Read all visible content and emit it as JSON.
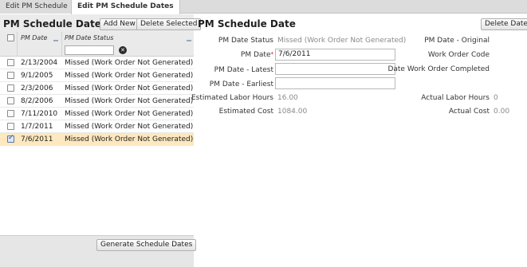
{
  "tabs": [
    {
      "label": "Edit PM Schedule"
    },
    {
      "label": "Edit PM Schedule Dates"
    }
  ],
  "left": {
    "title": "PM Schedule Dates",
    "add_label": "Add New",
    "delete_selected_label": "Delete Selected",
    "columns": {
      "date": "PM Date",
      "status": "PM Date Status"
    },
    "rows": [
      {
        "date": "2/13/2004",
        "status": "Missed (Work Order Not Generated)",
        "checked": false
      },
      {
        "date": "9/1/2005",
        "status": "Missed (Work Order Not Generated)",
        "checked": false
      },
      {
        "date": "2/3/2006",
        "status": "Missed (Work Order Not Generated)",
        "checked": false
      },
      {
        "date": "8/2/2006",
        "status": "Missed (Work Order Not Generated)",
        "checked": false
      },
      {
        "date": "7/11/2010",
        "status": "Missed (Work Order Not Generated)",
        "checked": false
      },
      {
        "date": "1/7/2011",
        "status": "Missed (Work Order Not Generated)",
        "checked": false
      },
      {
        "date": "7/6/2011",
        "status": "Missed (Work Order Not Generated)",
        "checked": true
      }
    ],
    "generate_label": "Generate Schedule Dates"
  },
  "right": {
    "title": "PM Schedule Date",
    "delete_label": "Delete Date",
    "fields": {
      "status_label": "PM Date Status",
      "status_value": "Missed (Work Order Not Generated)",
      "pm_date_label": "PM Date",
      "pm_date_value": "7/6/2011",
      "latest_label": "PM Date - Latest",
      "latest_value": "",
      "earliest_label": "PM Date - Earliest",
      "earliest_value": "",
      "est_hours_label": "Estimated Labor Hours",
      "est_hours_value": "16.00",
      "est_cost_label": "Estimated Cost",
      "est_cost_value": "1084.00",
      "original_label": "PM Date - Original",
      "original_value": "",
      "wo_code_label": "Work Order Code",
      "wo_code_value": "",
      "completed_label": "Date Work Order Completed",
      "completed_value": "",
      "actual_hours_label": "Actual Labor Hours",
      "actual_hours_value": "0",
      "actual_cost_label": "Actual Cost",
      "actual_cost_value": "0.00"
    },
    "required_mark": "*"
  },
  "colors": {
    "selected_row": "#fde8bf",
    "panel_bg": "#ebebeb"
  }
}
